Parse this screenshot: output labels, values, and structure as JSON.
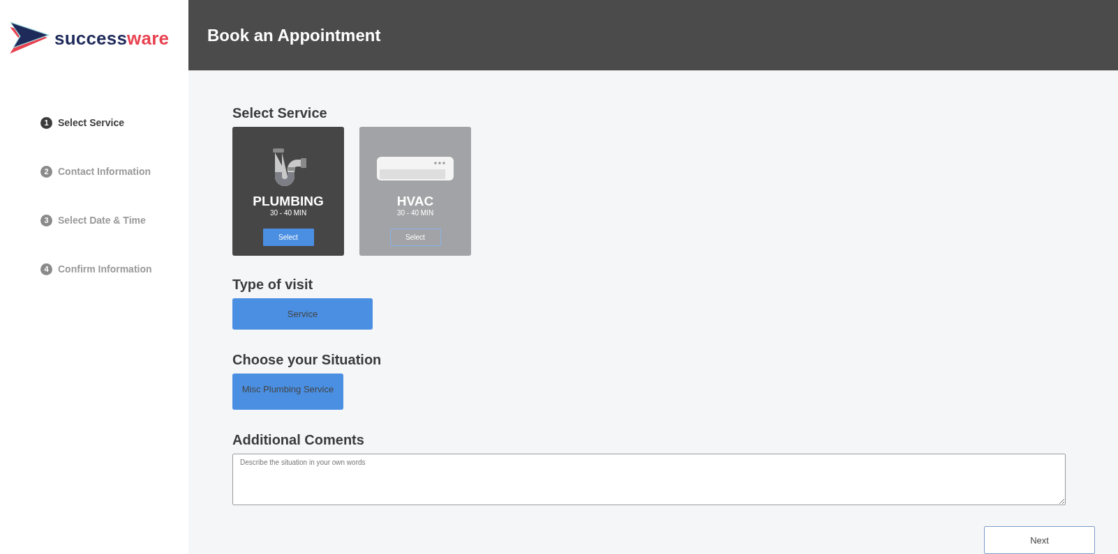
{
  "logo": {
    "parts": [
      "success",
      "ware"
    ]
  },
  "header": {
    "title": "Book an Appointment"
  },
  "steps": [
    {
      "number": "1",
      "label": "Select Service",
      "selected": true
    },
    {
      "number": "2",
      "label": "Contact Information",
      "selected": false
    },
    {
      "number": "3",
      "label": "Select Date & Time",
      "selected": false
    },
    {
      "number": "4",
      "label": "Confirm Information",
      "selected": false
    }
  ],
  "service_section": {
    "heading": "Select Service",
    "cards": [
      {
        "kind": "plumbing",
        "title": "PLUMBING",
        "duration": "30 - 40 MIN",
        "button": "Select",
        "selected": true
      },
      {
        "kind": "hvac",
        "title": "HVAC",
        "duration": "30 - 40 MIN",
        "button": "Select",
        "selected": false
      }
    ]
  },
  "visit_section": {
    "heading": "Type of visit",
    "options": [
      {
        "label": "Service",
        "selected": true
      }
    ]
  },
  "situation_section": {
    "heading": "Choose your Situation",
    "options": [
      {
        "label": "Misc Plumbing Service",
        "selected": true
      }
    ]
  },
  "comments_section": {
    "heading": "Additional Coments",
    "placeholder": "Describe the situation in your own words"
  },
  "next_button": "Next"
}
